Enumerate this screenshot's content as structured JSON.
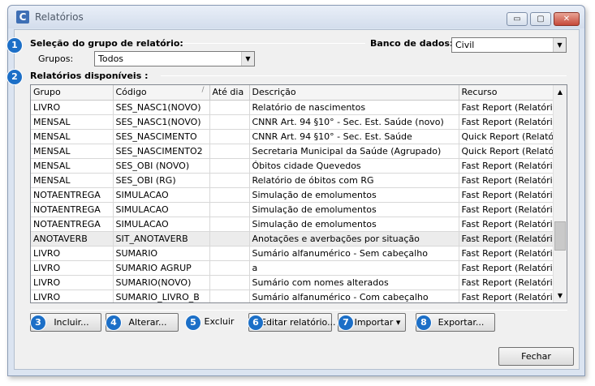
{
  "window": {
    "icon_letter": "C",
    "title": "Relatórios",
    "controls": {
      "minimize": "▭",
      "maximize": "▢",
      "close": "✕"
    }
  },
  "badges": [
    "1",
    "2",
    "3",
    "4",
    "5",
    "6",
    "7",
    "8"
  ],
  "group_section": {
    "heading": "Seleção do grupo de relatório:",
    "groups_label": "Grupos:",
    "groups_value": "Todos",
    "database_label": "Banco de dados:",
    "database_value": "Civil"
  },
  "reports_section": {
    "heading": "Relatórios disponíveis :"
  },
  "table": {
    "columns": [
      "Grupo",
      "Código",
      "Até dia",
      "Descrição",
      "Recurso"
    ],
    "sort_indicator": "/",
    "selected_row_index": 9,
    "rows": [
      [
        "LIVRO",
        "SES_NASC1(NOVO)",
        "",
        "Relatório de nascimentos",
        "Fast Report (Relatório"
      ],
      [
        "MENSAL",
        "SES_NASC1(NOVO)",
        "",
        "CNNR Art. 94 §10° - Sec. Est. Saúde (novo)",
        "Fast Report (Relatório"
      ],
      [
        "MENSAL",
        "SES_NASCIMENTO",
        "",
        "CNNR Art. 94 §10° - Sec. Est. Saúde",
        "Quick Report (Relatóri"
      ],
      [
        "MENSAL",
        "SES_NASCIMENTO2",
        "",
        "Secretaria Municipal da Saúde (Agrupado)",
        "Quick Report (Relatóri"
      ],
      [
        "MENSAL",
        "SES_OBI (NOVO)",
        "",
        "Óbitos cidade Quevedos",
        "Fast Report (Relatório"
      ],
      [
        "MENSAL",
        "SES_OBI (RG)",
        "",
        "Relatório de óbitos com RG",
        "Fast Report (Relatório"
      ],
      [
        "NOTAENTREGA",
        "SIMULACAO",
        "",
        "Simulação de emolumentos",
        "Fast Report (Relatório"
      ],
      [
        "NOTAENTREGA",
        "SIMULACAO",
        "",
        "Simulação de emolumentos",
        "Fast Report (Relatório"
      ],
      [
        "NOTAENTREGA",
        "SIMULACAO",
        "",
        "Simulação de emolumentos",
        "Fast Report (Relatório"
      ],
      [
        "ANOTAVERB",
        "SIT_ANOTAVERB",
        "",
        "Anotações e averbações por situação",
        "Fast Report (Relatório"
      ],
      [
        "LIVRO",
        "SUMARIO",
        "",
        "Sumário alfanumérico - Sem cabeçalho",
        "Fast Report (Relatório"
      ],
      [
        "LIVRO",
        "SUMARIO AGRUP",
        "",
        "a",
        "Fast Report (Relatório"
      ],
      [
        "LIVRO",
        "SUMARIO(NOVO)",
        "",
        "Sumário com nomes alterados",
        "Fast Report (Relatório"
      ],
      [
        "LIVRO",
        "SUMARIO_LIVRO_B",
        "",
        "Sumário alfanumérico - Com cabeçalho",
        "Fast Report (Relatório"
      ]
    ],
    "scroll_up": "▲",
    "scroll_down": "▼"
  },
  "actions": {
    "incluir": "Incluir...",
    "alterar": "Alterar...",
    "excluir": "Excluir",
    "editar": "Editar relatório...",
    "importar": "Importar ▾",
    "exportar": "Exportar...",
    "fechar": "Fechar"
  },
  "colors": {
    "badge": "#1c6fc7",
    "window_frame": "#dbe4f1",
    "selected_row": "#ececec"
  }
}
